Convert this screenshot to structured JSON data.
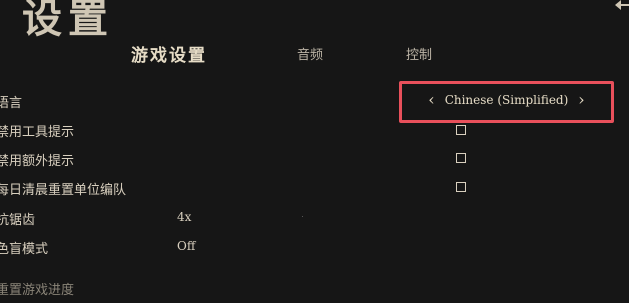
{
  "header": {
    "title": "设置"
  },
  "tabs": [
    {
      "label": "游戏设置",
      "active": true
    },
    {
      "label": "音频",
      "active": false
    },
    {
      "label": "控制",
      "active": false
    }
  ],
  "language": {
    "label": "语言",
    "value": "Chinese (Simplified)",
    "prev_glyph": "‹",
    "next_glyph": "›",
    "highlight_color": "#e8505b"
  },
  "options": {
    "disable_tooltips": "禁用工具提示",
    "disable_extra_tips": "禁用额外提示",
    "reset_units_daily": "每日清晨重置单位编队",
    "antialias_label": "抗锯齿",
    "antialias_value": "4x",
    "colorblind_label": "色盲模式",
    "colorblind_value": "Off",
    "reset_progress": "重置游戏进度"
  },
  "icons": {
    "back": "back-arrow-icon"
  }
}
